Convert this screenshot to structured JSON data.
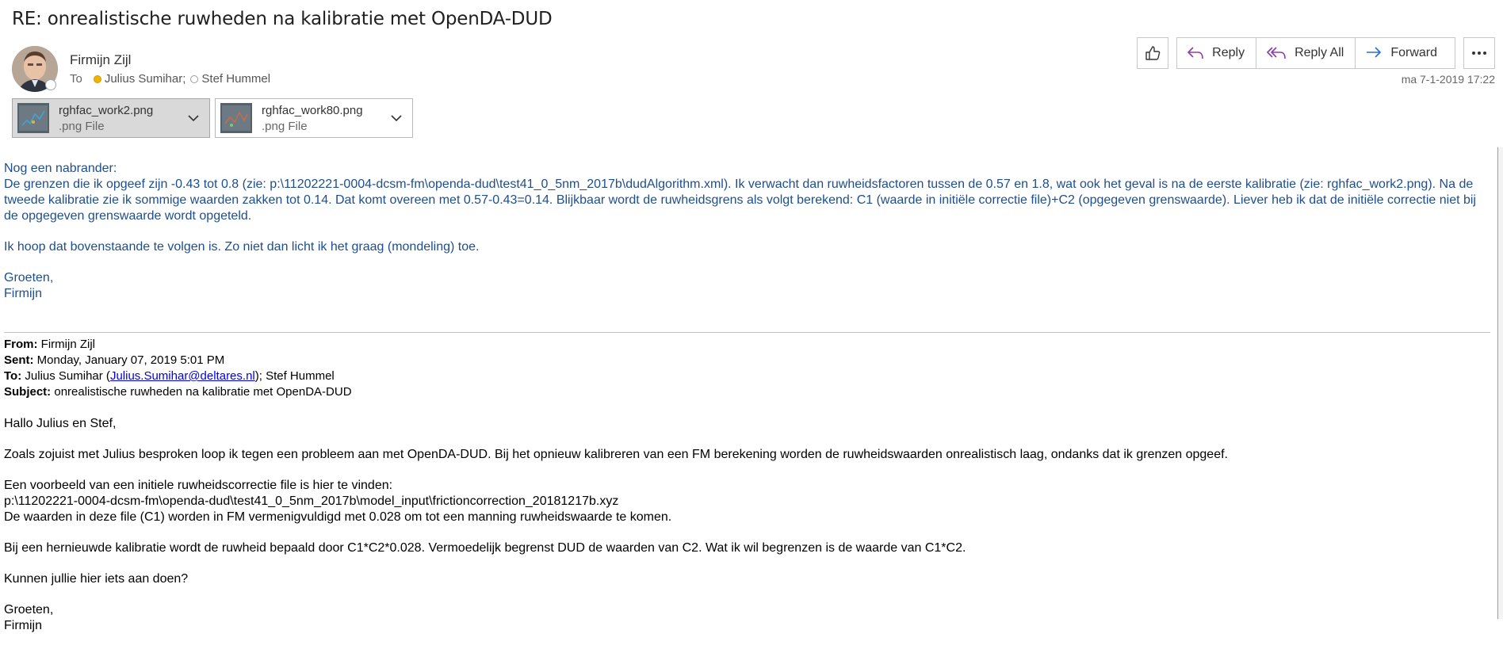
{
  "subject": "RE: onrealistische ruwheden na kalibratie met OpenDA-DUD",
  "sender": "Firmijn Zijl",
  "to_label": "To",
  "recipients": [
    {
      "name": "Julius Sumihar;",
      "status": "away"
    },
    {
      "name": "Stef Hummel",
      "status": "offline"
    }
  ],
  "date": "ma 7-1-2019 17:22",
  "attachments": [
    {
      "name": "rghfac_work2.png",
      "type": ".png File"
    },
    {
      "name": "rghfac_work80.png",
      "type": ".png File"
    }
  ],
  "actions": {
    "reply": "Reply",
    "reply_all": "Reply All",
    "forward": "Forward"
  },
  "reply_body": {
    "line1": "Nog een nabrander:",
    "line2": "De grenzen die ik opgeef zijn -0.43 tot 0.8 (zie: p:\\11202221-0004-dcsm-fm\\openda-dud\\test41_0_5nm_2017b\\dudAlgorithm.xml). Ik verwacht dan ruwheidsfactoren tussen de 0.57 en 1.8, wat ook het geval is na de eerste kalibratie (zie: rghfac_work2.png). Na de tweede kalibratie zie ik sommige waarden zakken tot 0.14. Dat komt overeen met 0.57-0.43=0.14. Blijkbaar wordt de ruwheidsgrens als volgt berekend: C1 (waarde in initiële correctie file)+C2 (opgegeven grenswaarde). Liever heb ik dat de initiële correctie niet bij de opgegeven grenswaarde wordt opgeteld.",
    "para2": "Ik hoop dat bovenstaande te volgen is. Zo niet dan licht ik het graag (mondeling) toe.",
    "greeting": "Groeten,",
    "signature": "Firmijn"
  },
  "quoted_header": {
    "from_label": "From:",
    "from": "Firmijn Zijl",
    "sent_label": "Sent:",
    "sent": "Monday, January 07, 2019 5:01 PM",
    "to_label": "To:",
    "to_prefix": "Julius Sumihar (",
    "to_email": "Julius.Sumihar@deltares.nl",
    "to_suffix": "); Stef Hummel",
    "subject_label": "Subject:",
    "subject": "onrealistische ruwheden na kalibratie met OpenDA-DUD"
  },
  "quoted_body": {
    "salutation": "Hallo Julius en Stef,",
    "p1": "Zoals zojuist met Julius besproken loop ik tegen een probleem aan met OpenDA-DUD. Bij het opnieuw kalibreren van een FM berekening worden de ruwheidswaarden onrealistisch laag, ondanks dat ik grenzen opgeef.",
    "p2_line1": "Een voorbeeld van een initiele ruwheidscorrectie file is hier te vinden:",
    "p2_line2": "p:\\11202221-0004-dcsm-fm\\openda-dud\\test41_0_5nm_2017b\\model_input\\frictioncorrection_20181217b.xyz",
    "p2_line3": "De waarden in deze file (C1) worden in FM vermenigvuldigd met 0.028 om tot een manning ruwheidswaarde te komen.",
    "p3": "Bij een hernieuwde kalibratie wordt de ruwheid bepaald door C1*C2*0.028. Vermoedelijk begrenst DUD de waarden van C2. Wat ik wil begrenzen is de waarde van C1*C2.",
    "p4": "Kunnen jullie hier iets aan doen?",
    "greeting": "Groeten,",
    "signature": "Firmijn"
  }
}
